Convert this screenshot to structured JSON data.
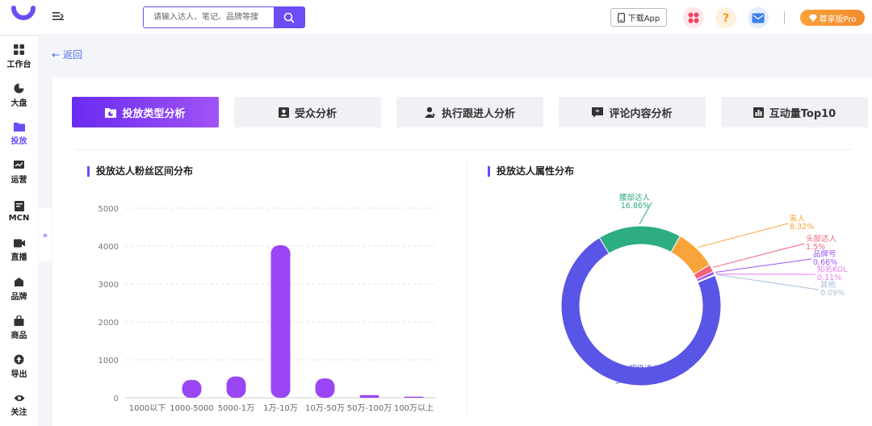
{
  "header": {
    "search_placeholder": "请输入达人、笔记、品牌等搜",
    "download_label": "下载App",
    "pro_label": "尊享版Pro",
    "brand_color": "#6c4cf5",
    "icons": [
      "logo-icon",
      "menu-icon",
      "search-icon",
      "phone-icon",
      "apps-icon",
      "help-icon",
      "mail-icon",
      "diamond-icon"
    ]
  },
  "sidebar": {
    "items": [
      {
        "label": "工作台",
        "icon": "grid-icon"
      },
      {
        "label": "大盘",
        "icon": "pie-icon"
      },
      {
        "label": "投放",
        "icon": "folder-icon"
      },
      {
        "label": "运营",
        "icon": "trend-icon"
      },
      {
        "label": "MCN",
        "icon": "doc-icon"
      },
      {
        "label": "直播",
        "icon": "video-icon"
      },
      {
        "label": "品牌",
        "icon": "brand-icon"
      },
      {
        "label": "商品",
        "icon": "bag-icon"
      },
      {
        "label": "导出",
        "icon": "export-icon"
      },
      {
        "label": "关注",
        "icon": "eye-icon"
      }
    ],
    "active": "投放",
    "collapse_label": "»"
  },
  "back_label": "← 返回",
  "tabs": [
    {
      "label": "投放类型分析",
      "icon": "pie-icon",
      "active": true
    },
    {
      "label": "受众分析",
      "icon": "idcard-icon",
      "active": false
    },
    {
      "label": "执行跟进人分析",
      "icon": "user-icon",
      "active": false
    },
    {
      "label": "评论内容分析",
      "icon": "quote-icon",
      "active": false
    },
    {
      "label": "互动量Top10",
      "icon": "barchart-icon",
      "active": false
    }
  ],
  "sections": {
    "left_title": "投放达人粉丝区间分布",
    "right_title": "投放达人属性分布"
  },
  "chart_data": [
    {
      "type": "bar",
      "categories": [
        "1000以下",
        "1000-5000",
        "5000-1万",
        "1万-10万",
        "10万-50万",
        "50万-100万",
        "100万以上"
      ],
      "values": [
        0,
        470,
        560,
        4020,
        510,
        70,
        30
      ],
      "ylim": [
        0,
        5000
      ],
      "yticks": [
        0,
        1000,
        2000,
        3000,
        4000,
        5000
      ],
      "grid": true,
      "bar_color": "#9b46f4"
    },
    {
      "type": "pie",
      "donut": true,
      "slices": [
        {
          "label": "腰部达人",
          "value": 16.86,
          "pct_label": "16.86%",
          "color": "#2eae80"
        },
        {
          "label": "素人",
          "value": 8.32,
          "pct_label": "8.32%",
          "color": "#f9a43a"
        },
        {
          "label": "头部达人",
          "value": 1.5,
          "pct_label": "1.5%",
          "color": "#f4617a"
        },
        {
          "label": "品牌号",
          "value": 0.66,
          "pct_label": "0.66%",
          "color": "#9b55f4"
        },
        {
          "label": "知名KOL",
          "value": 0.11,
          "pct_label": "0.11%",
          "color": "#e97af0"
        },
        {
          "label": "其他",
          "value": 0.09,
          "pct_label": "0.09%",
          "color": "#a9c0da"
        },
        {
          "label": "初级达人",
          "value": 72.46,
          "pct_label": "72.46%",
          "color": "#5955e6"
        }
      ]
    }
  ]
}
